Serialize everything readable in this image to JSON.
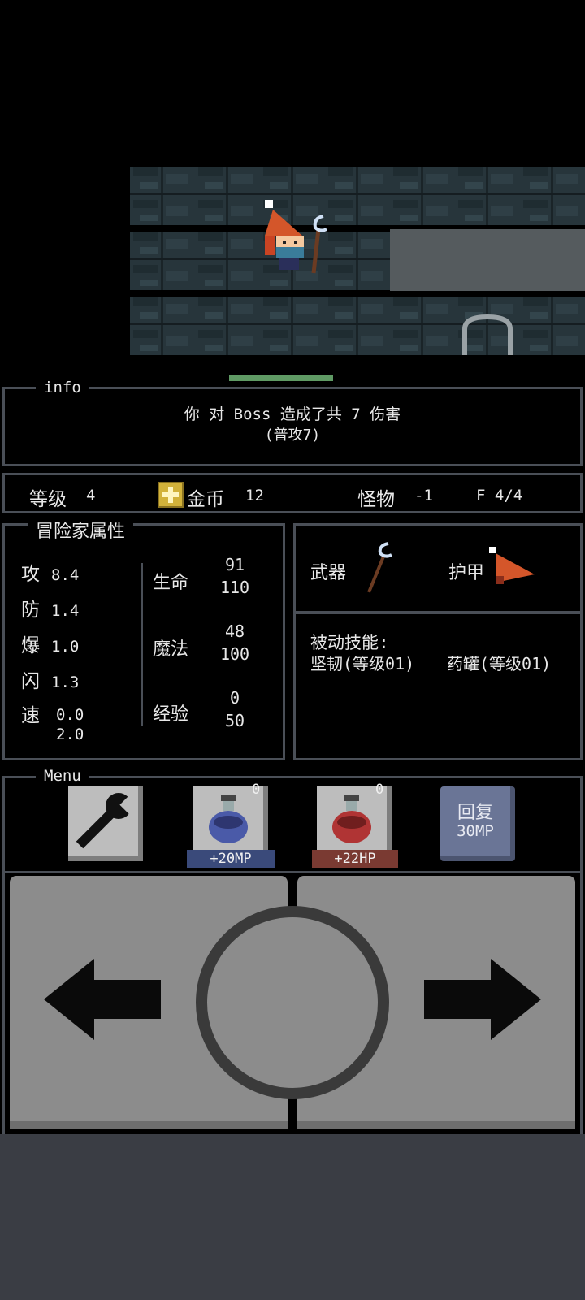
{
  "info": {
    "legend": "info",
    "message_line1": "你 对 Boss 造成了共 7 伤害",
    "message_line2": "(普攻7)"
  },
  "status_bar": {
    "level_label": "等级",
    "level_value": "4",
    "gold_label": "金币",
    "gold_value": "12",
    "monster_label": "怪物",
    "monster_value": "-1",
    "floor": "F 4/4"
  },
  "attributes": {
    "legend": "冒险家属性",
    "attack_label": "攻",
    "attack_value": "8.4",
    "defense_label": "防",
    "defense_value": "1.4",
    "crit_label": "爆",
    "crit_value": "1.0",
    "dodge_label": "闪",
    "dodge_value": "1.3",
    "speed_label": "速",
    "speed_value_1": "0.0",
    "speed_value_2": "2.0",
    "hp_label": "生命",
    "hp_current": "91",
    "hp_max": "110",
    "mp_label": "魔法",
    "mp_current": "48",
    "mp_max": "100",
    "exp_label": "经验",
    "exp_current": "0",
    "exp_max": "50"
  },
  "equipment": {
    "weapon_label": "武器",
    "armor_label": "护甲",
    "weapon_icon": "staff-icon",
    "armor_icon": "wizard-hat-icon"
  },
  "passive": {
    "title": "被动技能:",
    "skill1": "坚韧(等级01)",
    "skill2": "药罐(等级01)"
  },
  "menu": {
    "legend": "Menu",
    "mp_potion_count": "0",
    "mp_potion_label": "+20MP",
    "hp_potion_count": "0",
    "hp_potion_label": "+22HP",
    "restore_line1": "回复",
    "restore_line2": "30MP"
  },
  "player": {
    "boss_hp_fraction": 0.82
  },
  "colors": {
    "panel_border": "#4a4f57",
    "mp_tag": "#3a4a7a",
    "hp_tag": "#7a3a32",
    "restore_button": "#6a7596",
    "control_pad": "#8c8c8c",
    "hp_bar": "#5f9a64"
  }
}
